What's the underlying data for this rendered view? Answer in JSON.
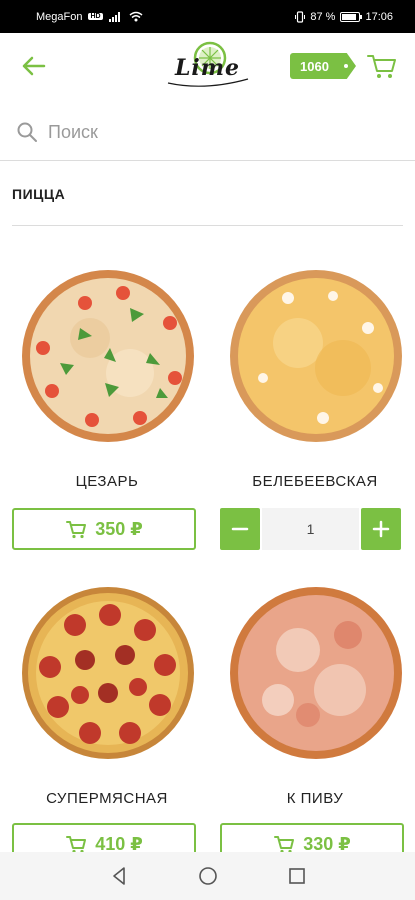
{
  "status_bar": {
    "carrier": "MegaFon",
    "network_badge": "HD",
    "battery_percent": "87 %",
    "battery_level": 0.87,
    "time": "17:06"
  },
  "header": {
    "logo_text": "Lime",
    "balance": "1060",
    "accent_color": "#7bc043"
  },
  "search": {
    "placeholder": "Поиск"
  },
  "category": {
    "title": "ПИЦЦА"
  },
  "products": [
    {
      "name": "ЦЕЗАРЬ",
      "price": "350 ₽",
      "state": "price"
    },
    {
      "name": "БЕЛЕБЕЕВСКАЯ",
      "quantity": "1",
      "state": "quantity"
    },
    {
      "name": "СУПЕРМЯСНАЯ",
      "price": "410 ₽",
      "state": "price"
    },
    {
      "name": "К ПИВУ",
      "price": "330 ₽",
      "state": "price"
    }
  ],
  "icons": {
    "back": "arrow-left-icon",
    "cart": "cart-icon",
    "search": "search-icon",
    "minus": "minus-icon",
    "plus": "plus-icon"
  }
}
